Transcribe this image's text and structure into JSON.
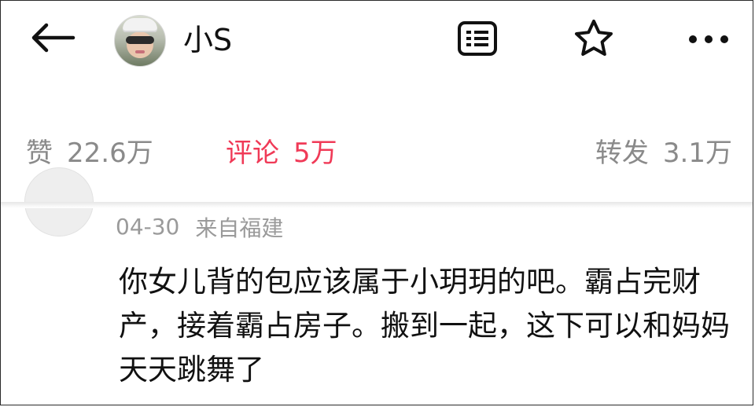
{
  "header": {
    "user_name": "小S"
  },
  "stats": {
    "likes_label": "赞",
    "likes_value": "22.6万",
    "comments_label": "评论",
    "comments_value": "5万",
    "reposts_label": "转发",
    "reposts_value": "3.1万"
  },
  "comment": {
    "date": "04-30",
    "location": "来自福建",
    "text": "你女儿背的包应该属于小玥玥的吧。霸占完财产，接着霸占房子。搬到一起，这下可以和妈妈天天跳舞了"
  },
  "colors": {
    "accent_active": "#f03a57",
    "muted_text": "#8a8a8a"
  },
  "icons": {
    "back": "back-arrow-icon",
    "menu": "list-icon",
    "favorite": "star-icon",
    "more": "more-dots-icon"
  }
}
